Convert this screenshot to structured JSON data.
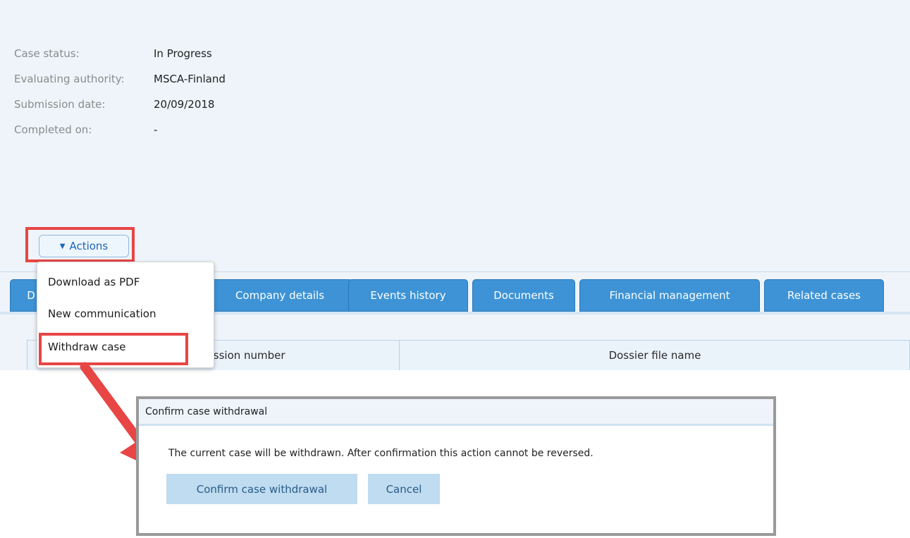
{
  "case_info": [
    {
      "label": "Case status:",
      "value": "In Progress"
    },
    {
      "label": "Evaluating authority:",
      "value": "MSCA-Finland"
    },
    {
      "label": "Submission date:",
      "value": "20/09/2018"
    },
    {
      "label": "Completed on:",
      "value": "-"
    }
  ],
  "actions": {
    "label": "Actions",
    "icon": "triangle-down-icon"
  },
  "actions_menu": [
    "Download as PDF",
    "New communication",
    "Withdraw case"
  ],
  "tabs": [
    "D",
    "Company details",
    "Events history",
    "Documents",
    "Financial management",
    "Related cases"
  ],
  "table": {
    "columns": [
      "mission number",
      "Dossier file name"
    ]
  },
  "dialog": {
    "title": "Confirm case withdrawal",
    "message": "The current case will be withdrawn. After confirmation this action cannot be reversed.",
    "confirm_label": "Confirm case withdrawal",
    "cancel_label": "Cancel"
  },
  "colors": {
    "tab_bg": "#3d93d6",
    "highlight": "#e84545",
    "accent": "#1a66b6",
    "dialog_button": "#bfdcf0"
  }
}
